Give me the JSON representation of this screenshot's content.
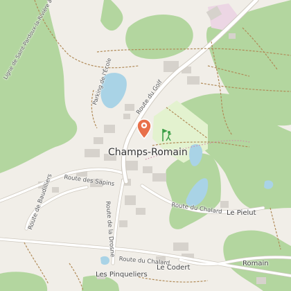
{
  "map": {
    "colors": {
      "background": "#f1eee8",
      "forest": "#b3d69f",
      "water": "#a9d3e6",
      "road": "#ffffff",
      "road_casing": "#cfc9bf",
      "building": "#d6d2cc",
      "golf_area": "#e3f2cf",
      "path": "#b08a57",
      "marker": "#e8704a",
      "golf_icon": "#3c9e48",
      "pink_area": "#ecd6e4"
    },
    "labels": {
      "town": "Champs-Romain",
      "route_du_golf": "Route du Golf",
      "parking_ecole": "Parking de l'École",
      "route_sapins": "Route des Sapins",
      "route_chalard_east": "Route du Chalard",
      "route_chalard_south": "Route du Chalard",
      "route_drosne": "Route de la Drosne",
      "route_baudilliers": "Route de Baudilliers",
      "ligne_saint_pardoux": "Ligne de Saint-Pardoux-la-Rivière à Saint-Mathieu",
      "le_pielut": "Le Pielut",
      "le_codert": "Le Codert",
      "romain": "Romain",
      "les_pinqueliers": "Les Pinqueliers"
    },
    "icons": {
      "marker": "map-pin-icon",
      "golf": "golf-icon"
    }
  }
}
